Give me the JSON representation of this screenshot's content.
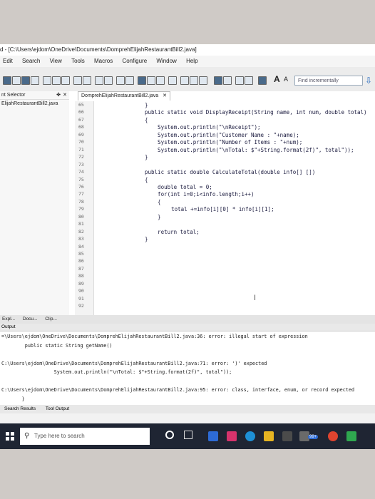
{
  "window": {
    "title": "d - [C:\\Users\\ejdom\\OneDrive\\Documents\\DomprehElijahRestaurantBill2.java]"
  },
  "menu": [
    "Edit",
    "Search",
    "View",
    "Tools",
    "Macros",
    "Configure",
    "Window",
    "Help"
  ],
  "toolbar": {
    "font_a_large": "A",
    "font_a_small": "A",
    "find_placeholder": "Find incrementally"
  },
  "sidebar": {
    "title": "nt Selector",
    "pin": "✤",
    "close": "✕",
    "item": "ElijahRestaurantBill2.java"
  },
  "editor": {
    "tab_label": "DomprehElijahRestaurantBill2.java",
    "tab_close": "✕",
    "line_numbers": [
      "65",
      "66",
      "67",
      "68",
      "69",
      "70",
      "71",
      "72",
      "73",
      "74",
      "75",
      "76",
      "77",
      "78",
      "79",
      "80",
      "81",
      "82",
      "83",
      "84",
      "85",
      "86",
      "87",
      "88",
      "89",
      "90",
      "91",
      "92"
    ],
    "code_lines": [
      "}",
      "public static void DisplayReceipt(String name, int num, double total)",
      "{",
      "    System.out.println(\"\\nReceipt\");",
      "    System.out.println(\"Customer Name : \"+name);",
      "    System.out.println(\"Number of Items : \"+num);",
      "    System.out.println(\"\\nTotal: $\"+String.format(2f)\", total\"));",
      "}",
      "",
      "public static double CalculateTotal(double info[] [])",
      "{",
      "    double total = 0;",
      "    for(int i=0;i<info.length;i++)",
      "    {",
      "      total +=info[i][0] * info[i][1];",
      "    }",
      "",
      "    return total;",
      "}"
    ]
  },
  "bottom_tabs": [
    "Expl...",
    "Docu...",
    "Clip..."
  ],
  "output": {
    "header": "Output",
    "lines": [
      "=\\Users\\ejdom\\OneDrive\\Documents\\DomprehElijahRestaurantBill2.java:36: error: illegal start of expression",
      "        public static String getName()",
      "",
      "C:\\Users\\ejdom\\OneDrive\\Documents\\DomprehElijahRestaurantBill2.java:71: error: ')' expected",
      "                  System.out.println(\"\\nTotal: $\"+String.format(2f)\", total\"));",
      "",
      "C:\\Users\\ejdom\\OneDrive\\Documents\\DomprehElijahRestaurantBill2.java:95: error: class, interface, enum, or record expected",
      "       }"
    ],
    "tabs": [
      "Search Results",
      "Tool Output"
    ]
  },
  "taskbar": {
    "search_placeholder": "Type here to search",
    "badge": "99+"
  },
  "colors": {
    "taskbar": "#1f2533",
    "code_text": "#1b1b3f",
    "find_icon": "#2c6fc2"
  }
}
